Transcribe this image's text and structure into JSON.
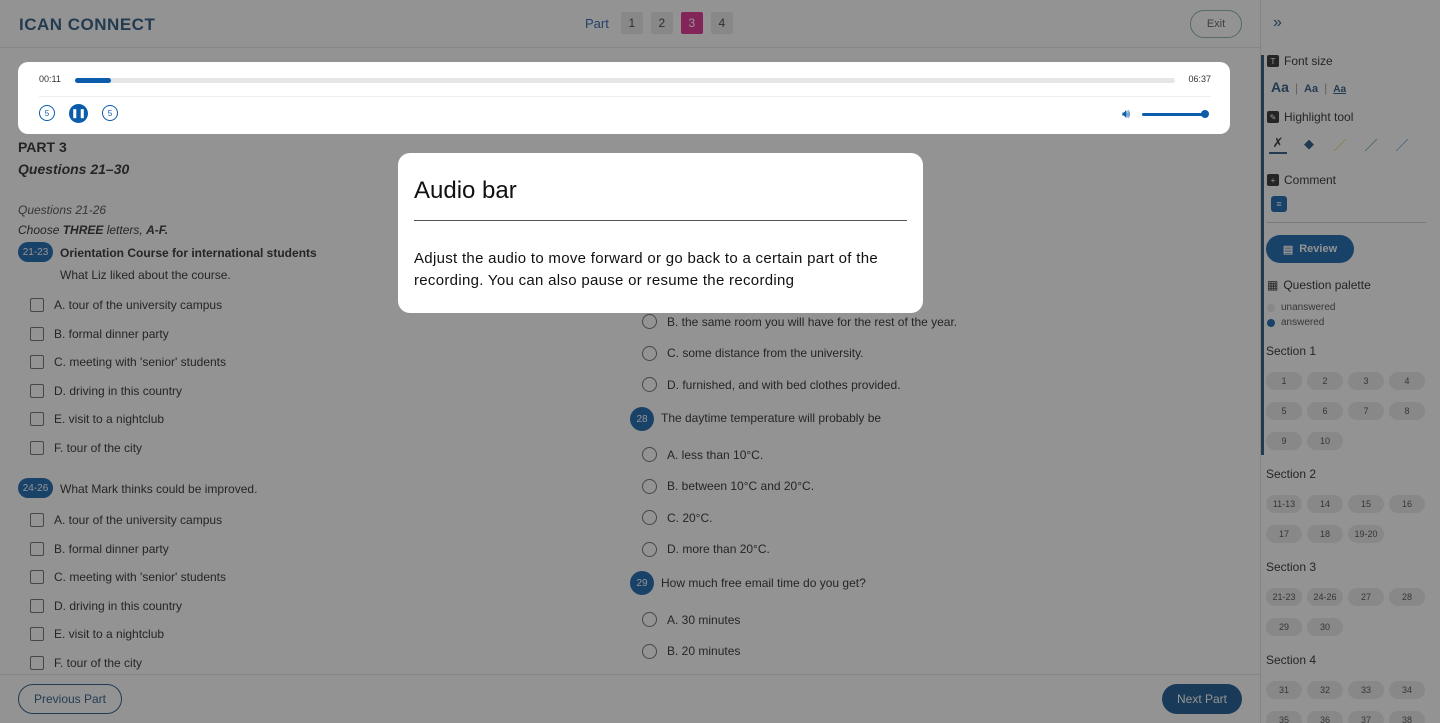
{
  "app": {
    "logo": "ICAN CONNECT",
    "exit_label": "Exit"
  },
  "parts": {
    "label": "Part",
    "items": [
      "1",
      "2",
      "3",
      "4"
    ],
    "active": "3"
  },
  "audio": {
    "current_time": "00:11",
    "total_time": "06:37",
    "progress_fraction": 0.033,
    "rewind_label": "5",
    "forward_label": "5",
    "volume_fraction": 1.0
  },
  "content": {
    "part_title": "PART 3",
    "question_range": "Questions 21–30",
    "sub_range": "Questions 21-26",
    "choose_prefix": "Choose ",
    "choose_bold": "THREE",
    "choose_mid": " letters, ",
    "choose_letters": "A-F.",
    "group1": {
      "badge": "21-23",
      "title": "Orientation Course for international students",
      "prompt": "What Liz liked about the course.",
      "options": [
        "A. tour of the university campus",
        "B. formal dinner party",
        "C. meeting with 'senior' students",
        "D. driving in this country",
        "E. visit to a nightclub",
        "F. tour of the city"
      ]
    },
    "group2": {
      "badge": "24-26",
      "prompt": "What Mark thinks could be improved.",
      "options": [
        "A. tour of the university campus",
        "B. formal dinner party",
        "C. meeting with 'senior' students",
        "D. driving in this country",
        "E. visit to a nightclub",
        "F. tour of the city"
      ]
    },
    "q27_options": [
      "B. the same room you will have for the rest of the year.",
      "C. some distance from the university.",
      "D. furnished, and with bed clothes provided."
    ],
    "q28": {
      "badge": "28",
      "question": "The daytime temperature will probably be",
      "options": [
        "A. less than 10°C.",
        "B. between 10°C and 20°C.",
        "C. 20°C.",
        "D. more than 20°C."
      ]
    },
    "q29": {
      "badge": "29",
      "question": "How much free email time do you get?",
      "options": [
        "A. 30 minutes",
        "B. 20 minutes"
      ]
    }
  },
  "footer": {
    "prev_label": "Previous Part",
    "next_label": "Next Part"
  },
  "sidebar": {
    "font_size_label": "Font size",
    "font_size_options": [
      "Aa",
      "Aa",
      "Aa"
    ],
    "highlight_label": "Highlight tool",
    "comment_label": "Comment",
    "review_label": "Review",
    "palette_label": "Question palette",
    "legend_unanswered": "unanswered",
    "legend_answered": "answered",
    "sections": [
      {
        "title": "Section 1",
        "items": [
          "1",
          "2",
          "3",
          "4",
          "5",
          "6",
          "7",
          "8",
          "9",
          "10"
        ]
      },
      {
        "title": "Section 2",
        "items": [
          "11-13",
          "14",
          "15",
          "16",
          "17",
          "18",
          "19-20"
        ]
      },
      {
        "title": "Section 3",
        "items": [
          "21-23",
          "24-26",
          "27",
          "28",
          "29",
          "30"
        ]
      },
      {
        "title": "Section 4",
        "items": [
          "31",
          "32",
          "33",
          "34",
          "35",
          "36",
          "37",
          "38"
        ]
      }
    ]
  },
  "tooltip": {
    "title": "Audio bar",
    "body": "Adjust the audio to move forward or go back to a certain part of the recording. You can also pause or resume the recording"
  }
}
